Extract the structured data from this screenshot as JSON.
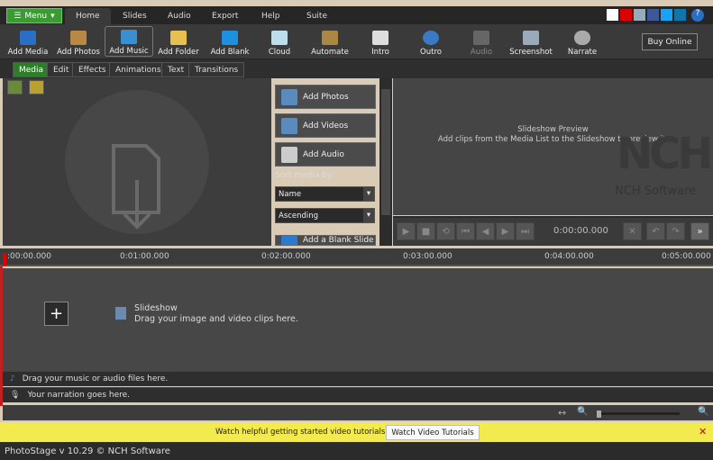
{
  "menu": {
    "label": "Menu"
  },
  "tabs": [
    "Home",
    "Slides",
    "Audio",
    "Export",
    "Help",
    "Suite"
  ],
  "toolbar": [
    {
      "label": "Add Media",
      "icon": "add-media-icon"
    },
    {
      "label": "Add Photos",
      "icon": "add-photos-icon"
    },
    {
      "label": "Add Music",
      "icon": "add-music-icon"
    },
    {
      "label": "Add Folder",
      "icon": "add-folder-icon"
    },
    {
      "label": "Add Blank",
      "icon": "add-blank-icon"
    },
    {
      "label": "Cloud",
      "icon": "cloud-icon"
    },
    {
      "label": "Automate",
      "icon": "automate-icon"
    },
    {
      "label": "Intro",
      "icon": "clapperboard-icon"
    },
    {
      "label": "Outro",
      "icon": "outro-icon"
    },
    {
      "label": "Audio",
      "icon": "audio-icon"
    },
    {
      "label": "Screenshot",
      "icon": "screenshot-icon"
    },
    {
      "label": "Narrate",
      "icon": "microphone-icon"
    }
  ],
  "buy_online": "Buy Online",
  "subtabs": [
    "Media",
    "Edit",
    "Effects",
    "Animations",
    "Text",
    "Transitions"
  ],
  "media_panel": {
    "add_photos": "Add Photos",
    "add_videos": "Add Videos",
    "add_audio": "Add Audio",
    "sort_label": "Sort media by:",
    "sort_field": "Name",
    "sort_order": "Ascending",
    "add_blank_slide": "Add a Blank Slide"
  },
  "preview": {
    "title": "Slideshow Preview",
    "hint": "Add clips from the Media List to the Slideshow to preview it.",
    "logo": "NCH",
    "logo_sub": "NCH Software",
    "time": "0:00:00.000"
  },
  "ruler": [
    ":00:00.000",
    "0:01:00.000",
    "0:02:00.000",
    "0:03:00.000",
    "0:04:00.000",
    "0:05:00.000"
  ],
  "slideshow": {
    "title": "Slideshow",
    "hint": "Drag your image and video clips here."
  },
  "audio_track": "Drag your music or audio files here.",
  "narration_track": "Your narration goes here.",
  "banner": {
    "text": "Watch helpful getting started video tutorials.",
    "button": "Watch Video Tutorials"
  },
  "status": "PhotoStage v 10.29 © NCH Software",
  "colors": {
    "accent_green": "#3c9a34",
    "banner_yellow": "#f2ea4e",
    "playhead_red": "#e00000"
  }
}
